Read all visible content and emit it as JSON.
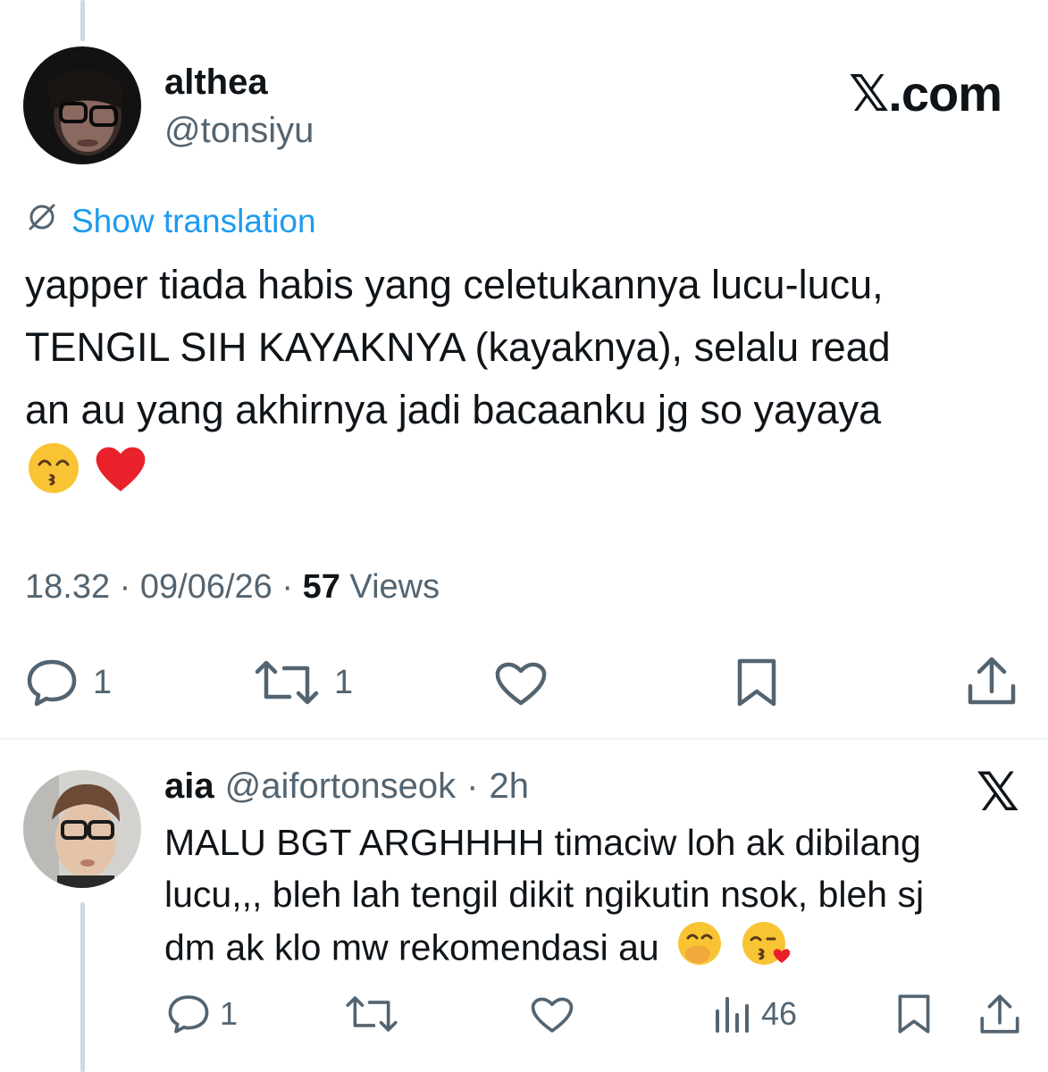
{
  "tweet": {
    "author_name": "althea",
    "author_handle": "@tonsiyu",
    "brand": "𝕏.com",
    "translation_label": "Show translation",
    "text_lines": [
      "yapper tiada habis yang celetukannya lucu-lucu,",
      "TENGIL SIH KAYAKNYA (kayaknya), selalu read",
      "an au yang akhirnya jadi bacaanku jg so yayaya"
    ],
    "emojis": [
      "kissing-smiling-eyes-emoji",
      "red-heart-emoji"
    ],
    "time": "18.32",
    "date": "09/06/26",
    "views_count": "57",
    "views_label": "Views",
    "separator": "·",
    "reply_count": "1",
    "repost_count": "1"
  },
  "reply": {
    "author_name": "aia",
    "author_handle": "@aifortonseok",
    "age": "2h",
    "separator": "·",
    "brand": "𝕏",
    "text_lines": [
      "MALU BGT ARGHHHH timaciw loh ak dibilang",
      "lucu,,, bleh lah tengil dikit ngikutin nsok, bleh sj",
      "dm ak klo mw rekomendasi au"
    ],
    "emojis": [
      "hand-over-mouth-emoji",
      "face-blowing-kiss-emoji"
    ],
    "reply_count": "1",
    "views_count": "46"
  },
  "colors": {
    "text": "#0f1419",
    "secondary": "#536471",
    "link": "#1d9bf0",
    "divider": "#eff3f4",
    "thread_line": "#cfd9de",
    "heart_red": "#e8212b",
    "emoji_yellow": "#f9c434"
  }
}
